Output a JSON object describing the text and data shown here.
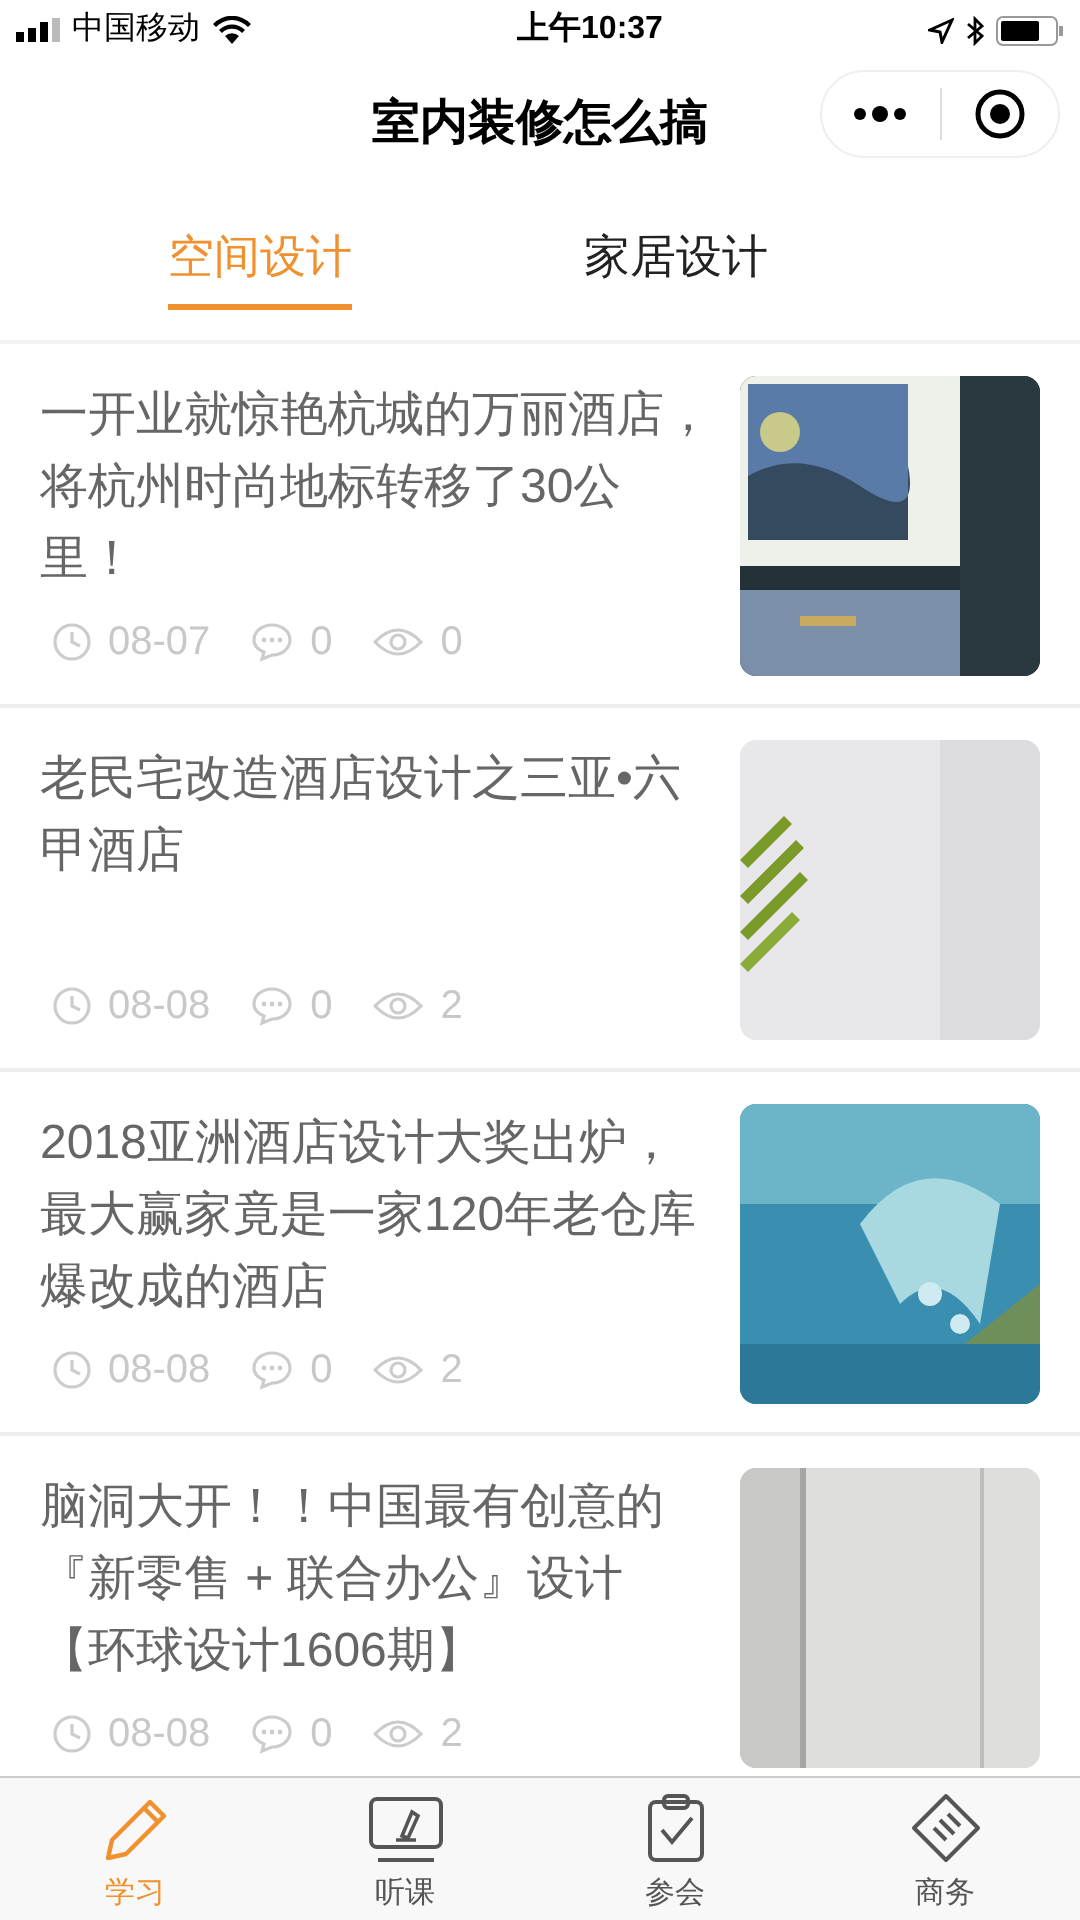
{
  "status_bar": {
    "carrier": "中国移动",
    "time": "上午10:37"
  },
  "nav": {
    "title": "室内装修怎么搞"
  },
  "tabs": [
    {
      "label": "空间设计",
      "selected": true
    },
    {
      "label": "家居设计",
      "selected": false
    }
  ],
  "articles": [
    {
      "title": "一开业就惊艳杭城的万丽酒店，将杭州时尚地标转移了30公里！",
      "date": "08-07",
      "comments": "0",
      "views": "0"
    },
    {
      "title": "老民宅改造酒店设计之三亚•六甲酒店",
      "date": "08-08",
      "comments": "0",
      "views": "2"
    },
    {
      "title": "2018亚洲酒店设计大奖出炉，最大赢家竟是一家120年老仓库爆改成的酒店",
      "date": "08-08",
      "comments": "0",
      "views": "2"
    },
    {
      "title": "脑洞大开！！中国最有创意的『新零售 + 联合办公』设计【环球设计1606期】",
      "date": "08-08",
      "comments": "0",
      "views": "2"
    }
  ],
  "tab_bar": [
    {
      "label": "学习",
      "selected": true,
      "kind": "pencil"
    },
    {
      "label": "听课",
      "selected": false,
      "kind": "board"
    },
    {
      "label": "参会",
      "selected": false,
      "kind": "clipboard"
    },
    {
      "label": "商务",
      "selected": false,
      "kind": "tag"
    }
  ]
}
